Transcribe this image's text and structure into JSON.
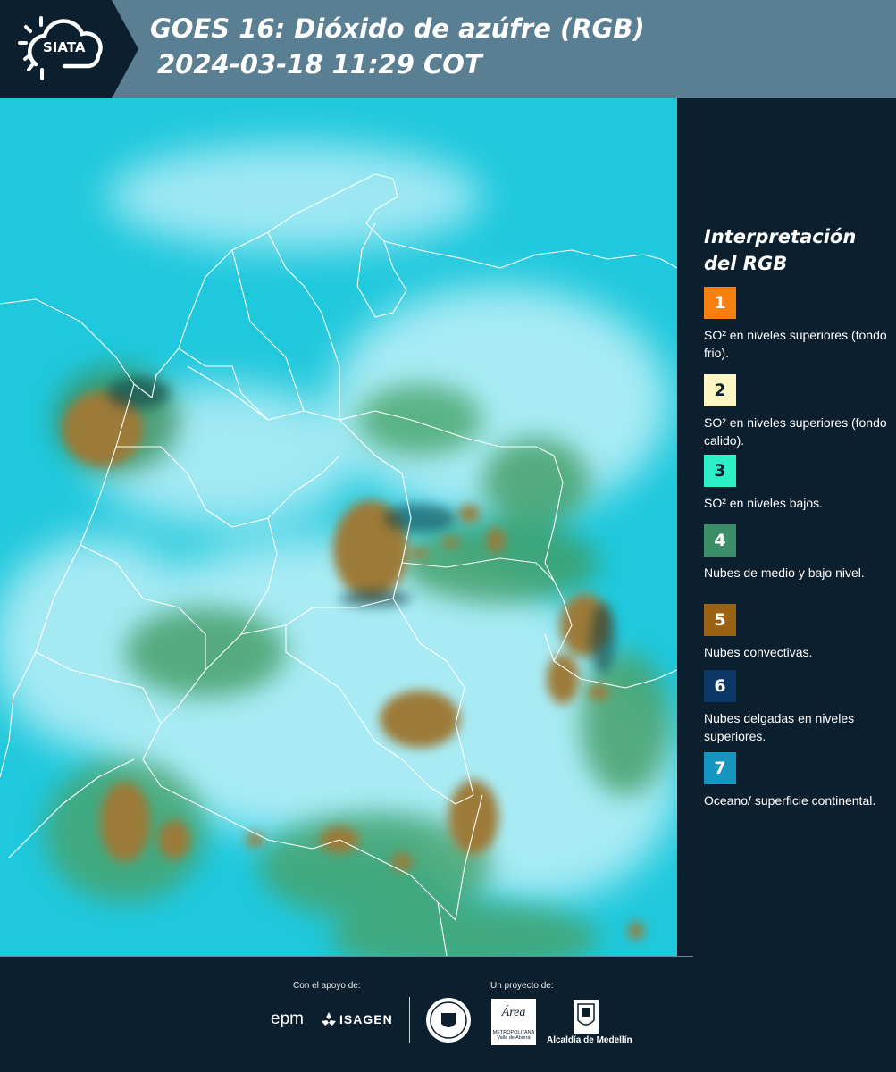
{
  "header": {
    "logo_text": "SIATA",
    "title_line1": "GOES 16: Dióxido de azúfre (RGB)",
    "title_line2": "2024-03-18 11:29 COT",
    "background_color": "#5a7f92"
  },
  "map": {
    "ocean_color": "#1fc8dc",
    "cloud_color": "#d9f5fb",
    "low_cloud_color": "#3b9e63",
    "convective_color": "#9c7a37",
    "border_color": "#ffffff"
  },
  "legend": {
    "title": "Interpretación del RGB",
    "items": [
      {
        "number": "1",
        "label": "SO² en niveles superiores (fondo frio).",
        "color": "#f77f0f",
        "text_color": "#ffffff"
      },
      {
        "number": "2",
        "label": "SO² en niveles superiores (fondo calido).",
        "color": "#fdf6c2",
        "text_color": "#0c1f2e"
      },
      {
        "number": "3",
        "label": "SO² en niveles bajos.",
        "color": "#2df0c8",
        "text_color": "#0c1f2e"
      },
      {
        "number": "4",
        "label": "Nubes de medio y bajo nivel.",
        "color": "#3b8f68",
        "text_color": "#ffffff"
      },
      {
        "number": "5",
        "label": "Nubes convectivas.",
        "color": "#9c6213",
        "text_color": "#ffffff"
      },
      {
        "number": "6",
        "label": "Nubes delgadas en niveles superiores.",
        "color": "#0c3868",
        "text_color": "#ffffff"
      },
      {
        "number": "7",
        "label": "Oceano/ superficie continental.",
        "color": "#1596c0",
        "text_color": "#ffffff"
      }
    ]
  },
  "footer": {
    "support_label": "Con el apoyo de:",
    "project_label": "Un proyecto de:",
    "epm_text": "epm",
    "isagen_text": "ISAGEN",
    "area_text_1": "Área",
    "area_text_2": "METROPOLITANA",
    "area_text_3": "Valle de Aburrá",
    "alcaldia_text": "Alcaldía de Medellín"
  }
}
